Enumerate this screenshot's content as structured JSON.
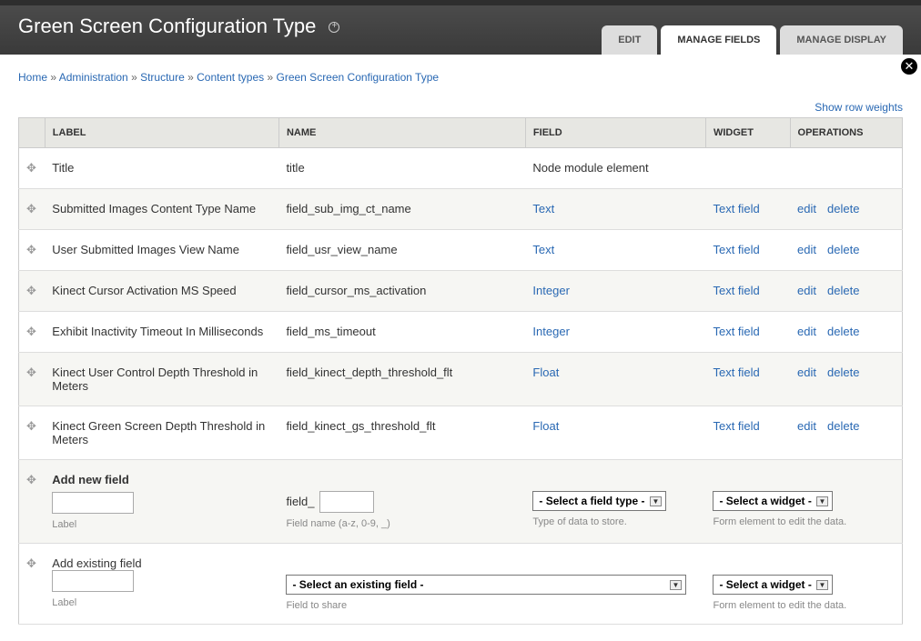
{
  "page_title": "Green Screen Configuration Type",
  "tabs": {
    "edit": "EDIT",
    "manage_fields": "MANAGE FIELDS",
    "manage_display": "MANAGE DISPLAY"
  },
  "breadcrumb": {
    "home": "Home",
    "administration": "Administration",
    "structure": "Structure",
    "content_types": "Content types",
    "current": "Green Screen Configuration Type"
  },
  "show_row_weights": "Show row weights",
  "columns": {
    "label": "LABEL",
    "name": "NAME",
    "field": "FIELD",
    "widget": "WIDGET",
    "operations": "OPERATIONS"
  },
  "rows": [
    {
      "label": "Title",
      "name": "title",
      "field_text": "Node module element",
      "field_link": false,
      "widget": "",
      "edit": false,
      "delete": false
    },
    {
      "label": "Submitted Images Content Type Name",
      "name": "field_sub_img_ct_name",
      "field_text": "Text",
      "field_link": true,
      "widget": "Text field",
      "edit": true,
      "delete": true
    },
    {
      "label": "User Submitted Images View Name",
      "name": "field_usr_view_name",
      "field_text": "Text",
      "field_link": true,
      "widget": "Text field",
      "edit": true,
      "delete": true
    },
    {
      "label": "Kinect Cursor Activation MS Speed",
      "name": "field_cursor_ms_activation",
      "field_text": "Integer",
      "field_link": true,
      "widget": "Text field",
      "edit": true,
      "delete": true
    },
    {
      "label": "Exhibit Inactivity Timeout In Milliseconds",
      "name": "field_ms_timeout",
      "field_text": "Integer",
      "field_link": true,
      "widget": "Text field",
      "edit": true,
      "delete": true
    },
    {
      "label": "Kinect User Control Depth Threshold in Meters",
      "name": "field_kinect_depth_threshold_flt",
      "field_text": "Float",
      "field_link": true,
      "widget": "Text field",
      "edit": true,
      "delete": true
    },
    {
      "label": "Kinect Green Screen Depth Threshold in Meters",
      "name": "field_kinect_gs_threshold_flt",
      "field_text": "Float",
      "field_link": true,
      "widget": "Text field",
      "edit": true,
      "delete": true
    }
  ],
  "ops": {
    "edit": "edit",
    "delete": "delete"
  },
  "add_new": {
    "heading": "Add new field",
    "label_help": "Label",
    "machine_prefix": "field_",
    "name_help": "Field name (a-z, 0-9, _)",
    "field_select": "- Select a field type -",
    "field_help": "Type of data to store.",
    "widget_select": "- Select a widget -",
    "widget_help": "Form element to edit the data."
  },
  "add_existing": {
    "heading": "Add existing field",
    "label_help": "Label",
    "field_select": "- Select an existing field -",
    "field_help": "Field to share",
    "widget_select": "- Select a widget -",
    "widget_help": "Form element to edit the data."
  }
}
